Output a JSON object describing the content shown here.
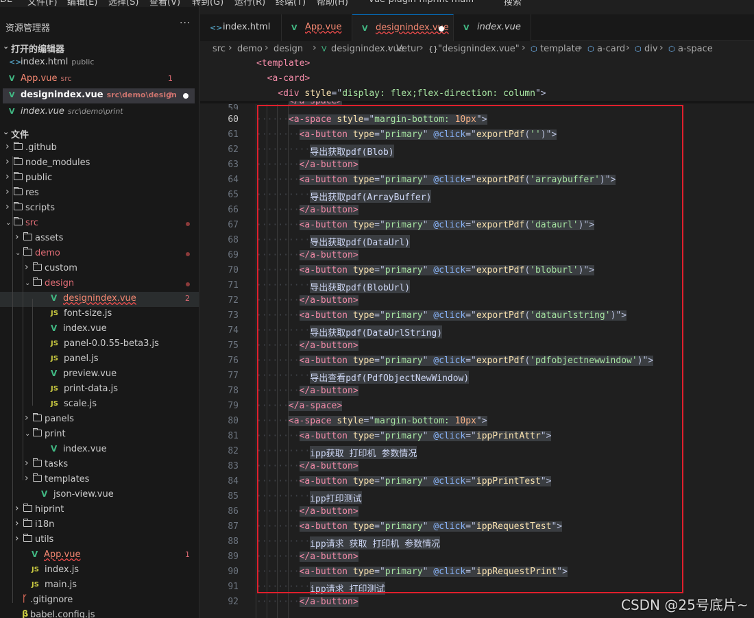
{
  "menubar": {
    "items": [
      "DE",
      "文件(F)",
      "编辑(E)",
      "选择(S)",
      "查看(V)",
      "转到(G)",
      "运行(R)",
      "终端(T)",
      "帮助(H)"
    ],
    "window_title": "vue-plugin-hiprint-main",
    "search": "搜索"
  },
  "sidebar": {
    "title": "资源管理器",
    "more": "···",
    "open_editors_label": "打开的编辑器",
    "open_editors": [
      {
        "name": "index.html",
        "dir": "public",
        "icon": "html-icon",
        "count": "",
        "dot": false,
        "active": false
      },
      {
        "name": "App.vue",
        "dir": "src",
        "icon": "vue-icon",
        "count": "1",
        "dot": false,
        "active": false
      },
      {
        "name": "designindex.vue",
        "dir": "src\\demo\\design",
        "icon": "vue-icon",
        "count": "2",
        "dot": true,
        "active": true
      },
      {
        "name": "index.vue",
        "dir": "src\\demo\\print",
        "icon": "vue-icon",
        "count": "",
        "dot": false,
        "active": false
      }
    ],
    "files_label": "文件",
    "tree": [
      {
        "name": ".github",
        "type": "folder",
        "depth": 0,
        "open": false
      },
      {
        "name": "node_modules",
        "type": "folder",
        "depth": 0,
        "open": false
      },
      {
        "name": "public",
        "type": "folder",
        "depth": 0,
        "open": false
      },
      {
        "name": "res",
        "type": "folder",
        "depth": 0,
        "open": false
      },
      {
        "name": "scripts",
        "type": "folder",
        "depth": 0,
        "open": false
      },
      {
        "name": "src",
        "type": "folder",
        "depth": 0,
        "open": true,
        "modified": true
      },
      {
        "name": "assets",
        "type": "folder",
        "depth": 1,
        "open": false
      },
      {
        "name": "demo",
        "type": "folder",
        "depth": 1,
        "open": true,
        "modified": true
      },
      {
        "name": "custom",
        "type": "folder",
        "depth": 2,
        "open": false
      },
      {
        "name": "design",
        "type": "folder",
        "depth": 2,
        "open": true,
        "modified": true
      },
      {
        "name": "designindex.vue",
        "type": "vue",
        "depth": 3,
        "badge": "2",
        "error": true,
        "selected": true
      },
      {
        "name": "font-size.js",
        "type": "js",
        "depth": 3
      },
      {
        "name": "index.vue",
        "type": "vue",
        "depth": 3
      },
      {
        "name": "panel-0.0.55-beta3.js",
        "type": "js",
        "depth": 3
      },
      {
        "name": "panel.js",
        "type": "js",
        "depth": 3
      },
      {
        "name": "preview.vue",
        "type": "vue",
        "depth": 3
      },
      {
        "name": "print-data.js",
        "type": "js",
        "depth": 3
      },
      {
        "name": "scale.js",
        "type": "js",
        "depth": 3
      },
      {
        "name": "panels",
        "type": "folder",
        "depth": 2,
        "open": false
      },
      {
        "name": "print",
        "type": "folder",
        "depth": 2,
        "open": true
      },
      {
        "name": "index.vue",
        "type": "vue",
        "depth": 3
      },
      {
        "name": "tasks",
        "type": "folder",
        "depth": 2,
        "open": false
      },
      {
        "name": "templates",
        "type": "folder",
        "depth": 2,
        "open": false
      },
      {
        "name": "json-view.vue",
        "type": "vue",
        "depth": 2
      },
      {
        "name": "hiprint",
        "type": "folder",
        "depth": 1,
        "open": false
      },
      {
        "name": "i18n",
        "type": "folder",
        "depth": 1,
        "open": false
      },
      {
        "name": "utils",
        "type": "folder",
        "depth": 1,
        "open": false
      },
      {
        "name": "App.vue",
        "type": "vue",
        "depth": 1,
        "badge": "1",
        "error": true
      },
      {
        "name": "index.js",
        "type": "js",
        "depth": 1
      },
      {
        "name": "main.js",
        "type": "js",
        "depth": 1
      },
      {
        "name": ".gitignore",
        "type": "git",
        "depth": 0
      },
      {
        "name": "babel.config.js",
        "type": "babel",
        "depth": 0
      }
    ]
  },
  "tabs": [
    {
      "name": "index.html",
      "icon": "html-icon",
      "active": false,
      "error": false,
      "dot": false,
      "italic": false
    },
    {
      "name": "App.vue",
      "icon": "vue-icon",
      "active": false,
      "error": true,
      "dot": false,
      "italic": false
    },
    {
      "name": "designindex.vue",
      "icon": "vue-icon",
      "active": true,
      "error": true,
      "dot": true,
      "italic": false
    },
    {
      "name": "index.vue",
      "icon": "vue-icon",
      "active": false,
      "error": false,
      "dot": false,
      "italic": true
    }
  ],
  "breadcrumb": [
    "src",
    "demo",
    "design",
    "designindex.vue",
    "Vetur",
    "\"designindex.vue\"",
    "template",
    "a-card",
    "div",
    "a-space"
  ],
  "sticky_lines": [
    {
      "indent": 0,
      "tokens": [
        [
          "tg",
          "<template>"
        ]
      ]
    },
    {
      "indent": 1,
      "tokens": [
        [
          "tg",
          "<a-card>"
        ]
      ]
    },
    {
      "indent": 2,
      "tokens": [
        [
          "tg",
          "<div"
        ],
        [
          "tx",
          " "
        ],
        [
          "at",
          "style"
        ],
        [
          "pl",
          "=\""
        ],
        [
          "st",
          "display: flex;flex-direction: column"
        ],
        [
          "pl",
          "\">"
        ]
      ]
    }
  ],
  "code_lines": [
    {
      "n": "59",
      "indent": 3,
      "tokens": [
        [
          "tg",
          "</a-space>"
        ]
      ],
      "partial": true
    },
    {
      "n": "60",
      "indent": 3,
      "cur": true,
      "tokens": [
        [
          "tg",
          "<a-space"
        ],
        [
          "tx",
          " "
        ],
        [
          "at",
          "style"
        ],
        [
          "pl",
          "=\""
        ],
        [
          "st",
          "margin-bottom: "
        ],
        [
          "nu",
          "10px"
        ],
        [
          "pl",
          "\">"
        ]
      ]
    },
    {
      "n": "61",
      "indent": 4,
      "tokens": [
        [
          "tg",
          "<a-button"
        ],
        [
          "tx",
          " "
        ],
        [
          "at",
          "type"
        ],
        [
          "pl",
          "=\""
        ],
        [
          "st",
          "primary"
        ],
        [
          "pl",
          "\" "
        ],
        [
          "ev",
          "@click"
        ],
        [
          "pl",
          "=\""
        ],
        [
          "at",
          "exportPdf"
        ],
        [
          "pl",
          "("
        ],
        [
          "st",
          "''"
        ],
        [
          "pl",
          ")\">"
        ]
      ]
    },
    {
      "n": "62",
      "indent": 5,
      "tokens": [
        [
          "tx",
          "导出获取pdf(Blob)"
        ]
      ]
    },
    {
      "n": "63",
      "indent": 4,
      "tokens": [
        [
          "tg",
          "</a-button>"
        ]
      ]
    },
    {
      "n": "64",
      "indent": 4,
      "tokens": [
        [
          "tg",
          "<a-button"
        ],
        [
          "tx",
          " "
        ],
        [
          "at",
          "type"
        ],
        [
          "pl",
          "=\""
        ],
        [
          "st",
          "primary"
        ],
        [
          "pl",
          "\" "
        ],
        [
          "ev",
          "@click"
        ],
        [
          "pl",
          "=\""
        ],
        [
          "at",
          "exportPdf"
        ],
        [
          "pl",
          "("
        ],
        [
          "st",
          "'arraybuffer'"
        ],
        [
          "pl",
          ")\">"
        ]
      ]
    },
    {
      "n": "65",
      "indent": 5,
      "tokens": [
        [
          "tx",
          "导出获取pdf(ArrayBuffer)"
        ]
      ]
    },
    {
      "n": "66",
      "indent": 4,
      "tokens": [
        [
          "tg",
          "</a-button>"
        ]
      ]
    },
    {
      "n": "67",
      "indent": 4,
      "tokens": [
        [
          "tg",
          "<a-button"
        ],
        [
          "tx",
          " "
        ],
        [
          "at",
          "type"
        ],
        [
          "pl",
          "=\""
        ],
        [
          "st",
          "primary"
        ],
        [
          "pl",
          "\" "
        ],
        [
          "ev",
          "@click"
        ],
        [
          "pl",
          "=\""
        ],
        [
          "at",
          "exportPdf"
        ],
        [
          "pl",
          "("
        ],
        [
          "st",
          "'dataurl'"
        ],
        [
          "pl",
          ")\">"
        ]
      ]
    },
    {
      "n": "68",
      "indent": 5,
      "tokens": [
        [
          "tx",
          "导出获取pdf(DataUrl)"
        ]
      ]
    },
    {
      "n": "69",
      "indent": 4,
      "tokens": [
        [
          "tg",
          "</a-button>"
        ]
      ]
    },
    {
      "n": "70",
      "indent": 4,
      "tokens": [
        [
          "tg",
          "<a-button"
        ],
        [
          "tx",
          " "
        ],
        [
          "at",
          "type"
        ],
        [
          "pl",
          "=\""
        ],
        [
          "st",
          "primary"
        ],
        [
          "pl",
          "\" "
        ],
        [
          "ev",
          "@click"
        ],
        [
          "pl",
          "=\""
        ],
        [
          "at",
          "exportPdf"
        ],
        [
          "pl",
          "("
        ],
        [
          "st",
          "'bloburl'"
        ],
        [
          "pl",
          ")\">"
        ]
      ]
    },
    {
      "n": "71",
      "indent": 5,
      "tokens": [
        [
          "tx",
          "导出获取pdf(BlobUrl)"
        ]
      ]
    },
    {
      "n": "72",
      "indent": 4,
      "tokens": [
        [
          "tg",
          "</a-button>"
        ]
      ]
    },
    {
      "n": "73",
      "indent": 4,
      "tokens": [
        [
          "tg",
          "<a-button"
        ],
        [
          "tx",
          " "
        ],
        [
          "at",
          "type"
        ],
        [
          "pl",
          "=\""
        ],
        [
          "st",
          "primary"
        ],
        [
          "pl",
          "\" "
        ],
        [
          "ev",
          "@click"
        ],
        [
          "pl",
          "=\""
        ],
        [
          "at",
          "exportPdf"
        ],
        [
          "pl",
          "("
        ],
        [
          "st",
          "'dataurlstring'"
        ],
        [
          "pl",
          ")\">"
        ]
      ]
    },
    {
      "n": "74",
      "indent": 5,
      "tokens": [
        [
          "tx",
          "导出获取pdf(DataUrlString)"
        ]
      ]
    },
    {
      "n": "75",
      "indent": 4,
      "tokens": [
        [
          "tg",
          "</a-button>"
        ]
      ]
    },
    {
      "n": "76",
      "indent": 4,
      "tokens": [
        [
          "tg",
          "<a-button"
        ],
        [
          "tx",
          " "
        ],
        [
          "at",
          "type"
        ],
        [
          "pl",
          "=\""
        ],
        [
          "st",
          "primary"
        ],
        [
          "pl",
          "\" "
        ],
        [
          "ev",
          "@click"
        ],
        [
          "pl",
          "=\""
        ],
        [
          "at",
          "exportPdf"
        ],
        [
          "pl",
          "("
        ],
        [
          "st",
          "'pdfobjectnewwindow'"
        ],
        [
          "pl",
          ")\">"
        ]
      ]
    },
    {
      "n": "77",
      "indent": 5,
      "tokens": [
        [
          "tx",
          "导出查看pdf(PdfObjectNewWindow)"
        ]
      ]
    },
    {
      "n": "78",
      "indent": 4,
      "tokens": [
        [
          "tg",
          "</a-button>"
        ]
      ]
    },
    {
      "n": "79",
      "indent": 3,
      "tokens": [
        [
          "tg",
          "</a-space>"
        ]
      ]
    },
    {
      "n": "80",
      "indent": 3,
      "tokens": [
        [
          "tg",
          "<a-space"
        ],
        [
          "tx",
          " "
        ],
        [
          "at",
          "style"
        ],
        [
          "pl",
          "=\""
        ],
        [
          "st",
          "margin-bottom: "
        ],
        [
          "nu",
          "10px"
        ],
        [
          "pl",
          "\">"
        ]
      ]
    },
    {
      "n": "81",
      "indent": 4,
      "tokens": [
        [
          "tg",
          "<a-button"
        ],
        [
          "tx",
          " "
        ],
        [
          "at",
          "type"
        ],
        [
          "pl",
          "=\""
        ],
        [
          "st",
          "primary"
        ],
        [
          "pl",
          "\" "
        ],
        [
          "ev",
          "@click"
        ],
        [
          "pl",
          "=\""
        ],
        [
          "at",
          "ippPrintAttr"
        ],
        [
          "pl",
          "\">"
        ]
      ]
    },
    {
      "n": "82",
      "indent": 5,
      "tokens": [
        [
          "tx",
          "ipp获取 打印机 参数情况"
        ]
      ]
    },
    {
      "n": "83",
      "indent": 4,
      "tokens": [
        [
          "tg",
          "</a-button>"
        ]
      ]
    },
    {
      "n": "84",
      "indent": 4,
      "tokens": [
        [
          "tg",
          "<a-button"
        ],
        [
          "tx",
          " "
        ],
        [
          "at",
          "type"
        ],
        [
          "pl",
          "=\""
        ],
        [
          "st",
          "primary"
        ],
        [
          "pl",
          "\" "
        ],
        [
          "ev",
          "@click"
        ],
        [
          "pl",
          "=\""
        ],
        [
          "at",
          "ippPrintTest"
        ],
        [
          "pl",
          "\">"
        ]
      ]
    },
    {
      "n": "85",
      "indent": 5,
      "tokens": [
        [
          "tx",
          "ipp打印测试"
        ]
      ]
    },
    {
      "n": "86",
      "indent": 4,
      "tokens": [
        [
          "tg",
          "</a-button>"
        ]
      ]
    },
    {
      "n": "87",
      "indent": 4,
      "tokens": [
        [
          "tg",
          "<a-button"
        ],
        [
          "tx",
          " "
        ],
        [
          "at",
          "type"
        ],
        [
          "pl",
          "=\""
        ],
        [
          "st",
          "primary"
        ],
        [
          "pl",
          "\" "
        ],
        [
          "ev",
          "@click"
        ],
        [
          "pl",
          "=\""
        ],
        [
          "at",
          "ippRequestTest"
        ],
        [
          "pl",
          "\">"
        ]
      ]
    },
    {
      "n": "88",
      "indent": 5,
      "tokens": [
        [
          "tx",
          "ipp请求 获取 打印机 参数情况"
        ]
      ]
    },
    {
      "n": "89",
      "indent": 4,
      "tokens": [
        [
          "tg",
          "</a-button>"
        ]
      ]
    },
    {
      "n": "90",
      "indent": 4,
      "tokens": [
        [
          "tg",
          "<a-button"
        ],
        [
          "tx",
          " "
        ],
        [
          "at",
          "type"
        ],
        [
          "pl",
          "=\""
        ],
        [
          "st",
          "primary"
        ],
        [
          "pl",
          "\" "
        ],
        [
          "ev",
          "@click"
        ],
        [
          "pl",
          "=\""
        ],
        [
          "at",
          "ippRequestPrint"
        ],
        [
          "pl",
          "\">"
        ]
      ]
    },
    {
      "n": "91",
      "indent": 5,
      "tokens": [
        [
          "tx",
          "ipp请求 打印测试"
        ]
      ]
    },
    {
      "n": "92",
      "indent": 4,
      "tokens": [
        [
          "tg",
          "</a-button>"
        ]
      ]
    }
  ],
  "watermark": "CSDN @25号底片~",
  "colors": {
    "highlight_box": "#e01f2c",
    "vue": "#41b883",
    "js": "#cbcb41",
    "error": "#f48771",
    "accent": "#0078d4"
  }
}
